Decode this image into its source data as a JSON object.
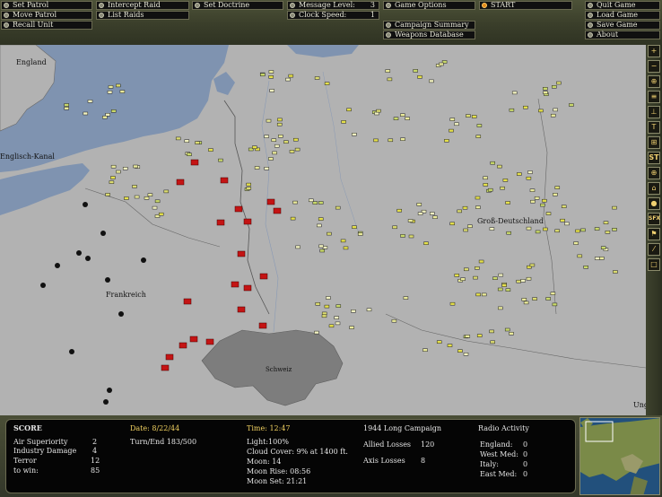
{
  "toolbar": {
    "set_patrol": "Set Patrol",
    "move_patrol": "Move Patrol",
    "recall_unit": "Recall Unit",
    "intercept_raid": "Intercept Raid",
    "list_raids": "List Raids",
    "set_doctrine": "Set Doctrine",
    "message_level_label": "Message Level:",
    "message_level_value": "3",
    "clock_speed_label": "Clock Speed:",
    "clock_speed_value": "1",
    "game_options": "Game Options",
    "campaign_summary": "Campaign Summary",
    "weapons_database": "Weapons Database",
    "start": "START",
    "quit_game": "Quit Game",
    "load_game": "Load Game",
    "save_game": "Save Game",
    "about": "About"
  },
  "map": {
    "labels": {
      "england": "England",
      "channel": "Englisch-Kanal",
      "frankreich": "Frankreich",
      "schweiz": "Schweiz",
      "grossdeutschland": "Groß-Deutschland",
      "ungarn": "Ungarn"
    }
  },
  "sidebar": {
    "buttons": [
      "zoom-in",
      "zoom-out",
      "center",
      "filter",
      "tree",
      "route",
      "grid",
      "st",
      "target",
      "radar",
      "bomb",
      "sfx",
      "flag",
      "pen",
      "square"
    ],
    "st_label": "ST",
    "sfx_label": "SFX"
  },
  "status": {
    "score_title": "SCORE",
    "air_superiority_label": "Air Superiority",
    "air_superiority_value": "2",
    "industry_damage_label": "Industry Damage",
    "industry_damage_value": "4",
    "terror_label": "Terror",
    "terror_value": "12",
    "to_win_label": "to win:",
    "to_win_value": "85",
    "date": "Date: 8/22/44",
    "turn_end": "Turn/End 183/500",
    "time": "Time: 12:47",
    "light": "Light:100%",
    "cloud_cover": "Cloud Cover: 9% at 1400 ft.",
    "moon": "Moon: 14",
    "moon_rise": "Moon Rise: 08:56",
    "moon_set": "Moon Set: 21:21",
    "campaign": "1944 Long Campaign",
    "allied_losses_label": "Allied Losses",
    "allied_losses_value": "120",
    "axis_losses_label": "Axis Losses",
    "axis_losses_value": "8",
    "radio_title": "Radio Activity",
    "radio": [
      {
        "name": "England:",
        "value": "0"
      },
      {
        "name": "West Med:",
        "value": "0"
      },
      {
        "name": "Italy:",
        "value": "0"
      },
      {
        "name": "East Med:",
        "value": "0"
      }
    ]
  },
  "colors": {
    "land": "#b2b2b2",
    "sea": "#7f93b0",
    "swiss": "#7d7d7d",
    "allied_unit": "#c41414",
    "axis_unit": "#e6e14a",
    "gold_text": "#f0d060"
  }
}
